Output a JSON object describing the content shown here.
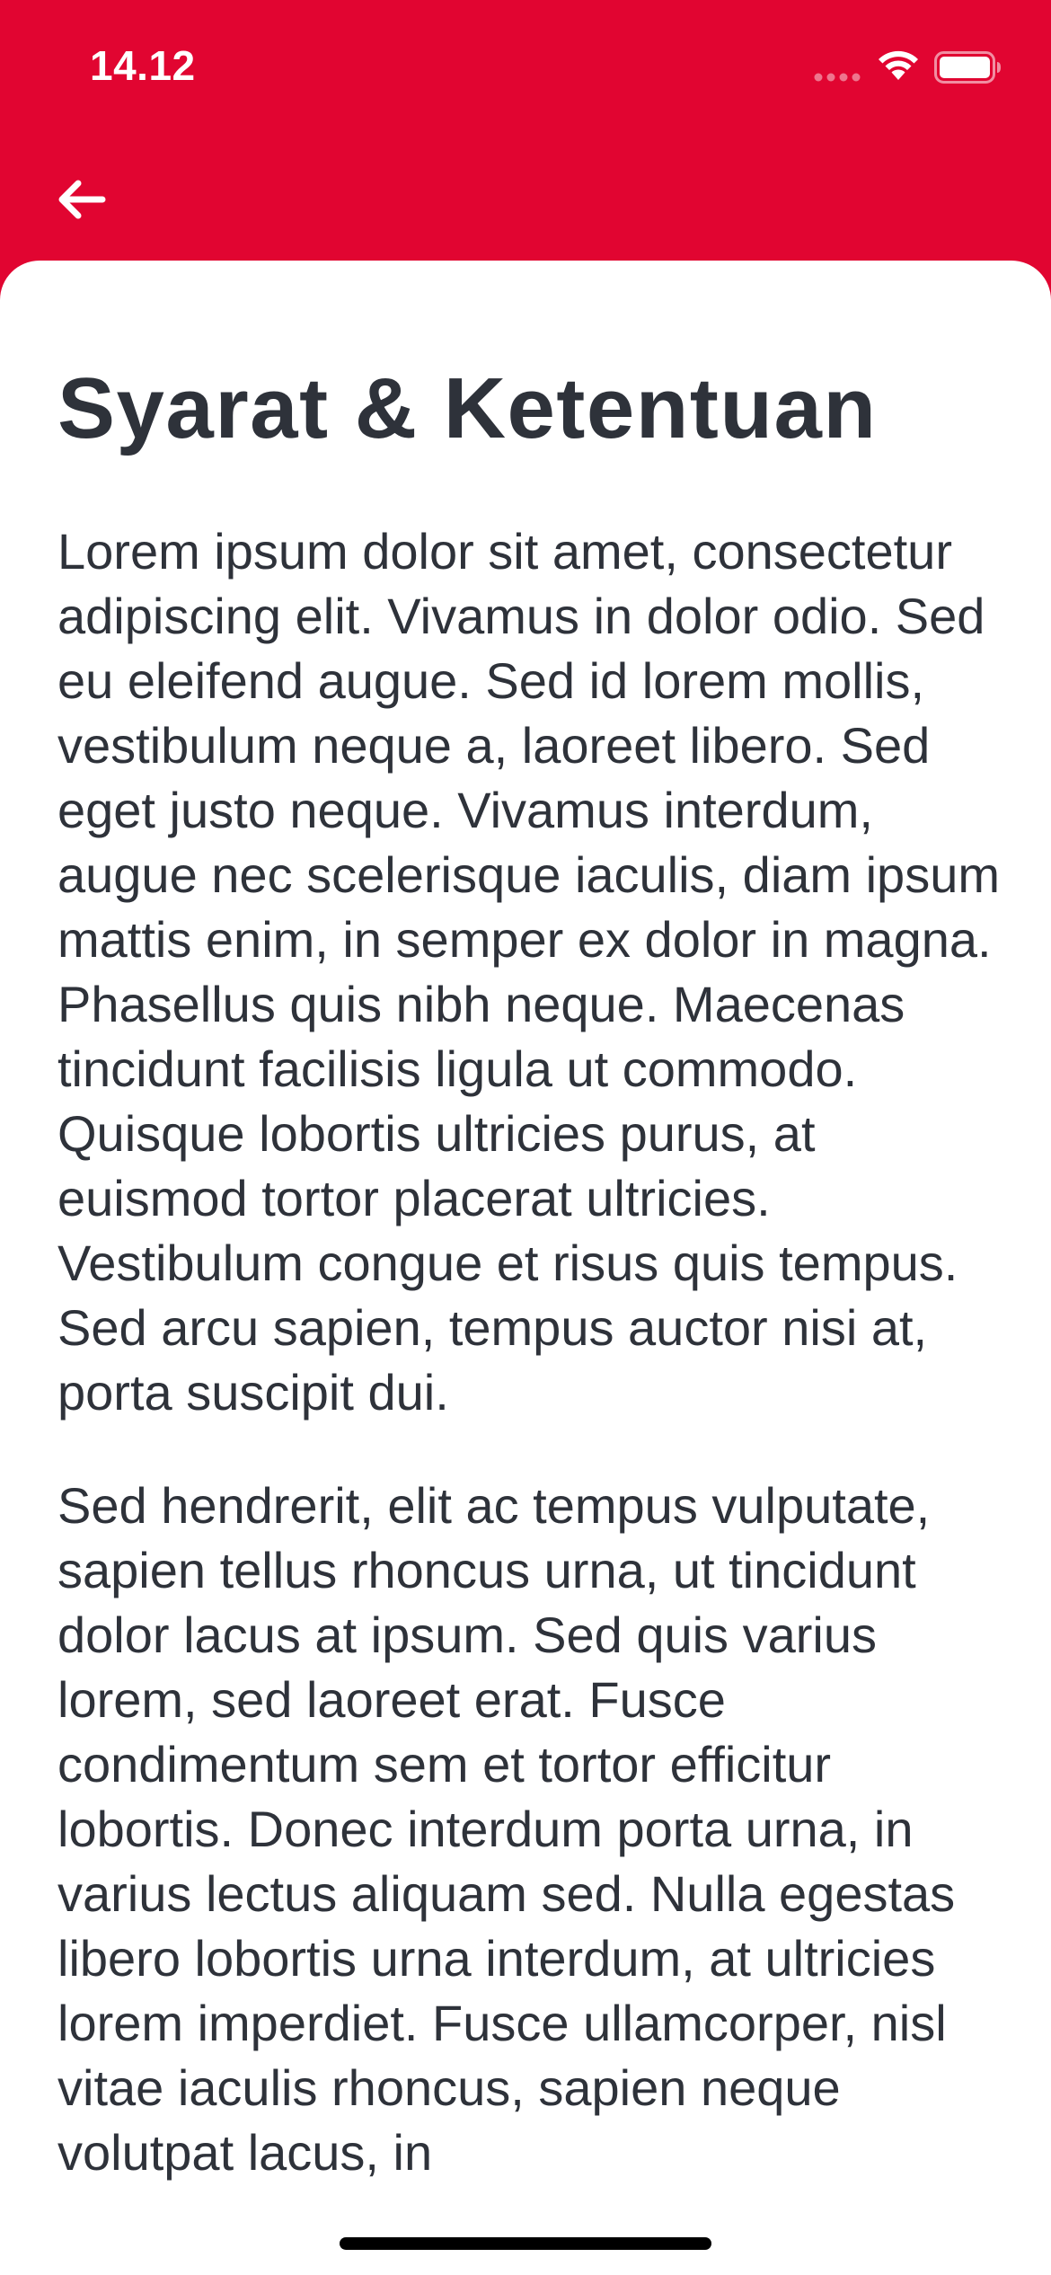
{
  "status_bar": {
    "time": "14.12",
    "signal_icon": "cellular-signal-icon",
    "wifi_icon": "wifi-icon",
    "battery_icon": "battery-icon"
  },
  "nav": {
    "back_icon": "arrow-left-icon"
  },
  "page": {
    "title": "Syarat & Ketentuan",
    "paragraphs": [
      "Lorem ipsum dolor sit amet, consectetur adipiscing elit. Vivamus in dolor odio. Sed eu eleifend augue. Sed id lorem mollis, vestibulum neque a, laoreet libero. Sed eget justo neque. Vivamus interdum, augue nec scelerisque iaculis, diam ipsum mattis enim, in semper ex dolor in magna. Phasellus quis nibh neque. Maecenas tincidunt facilisis ligula ut commodo. Quisque lobortis ultricies purus, at euismod tortor placerat ultricies. Vestibulum congue et risus quis tempus. Sed arcu sapien, tempus auctor nisi at, porta suscipit dui.",
      "Sed hendrerit, elit ac tempus vulputate, sapien tellus rhoncus urna, ut tincidunt dolor lacus at ipsum. Sed quis varius lorem, sed laoreet erat. Fusce condimentum sem et tortor efficitur lobortis. Donec interdum porta urna, in varius lectus aliquam sed. Nulla egestas libero lobortis urna interdum, at ultricies lorem imperdiet. Fusce ullamcorper, nisl vitae iaculis rhoncus, sapien neque volutpat lacus, in"
    ]
  },
  "colors": {
    "header": "#E10531",
    "card": "#FFFFFF",
    "text": "#2E323A"
  }
}
